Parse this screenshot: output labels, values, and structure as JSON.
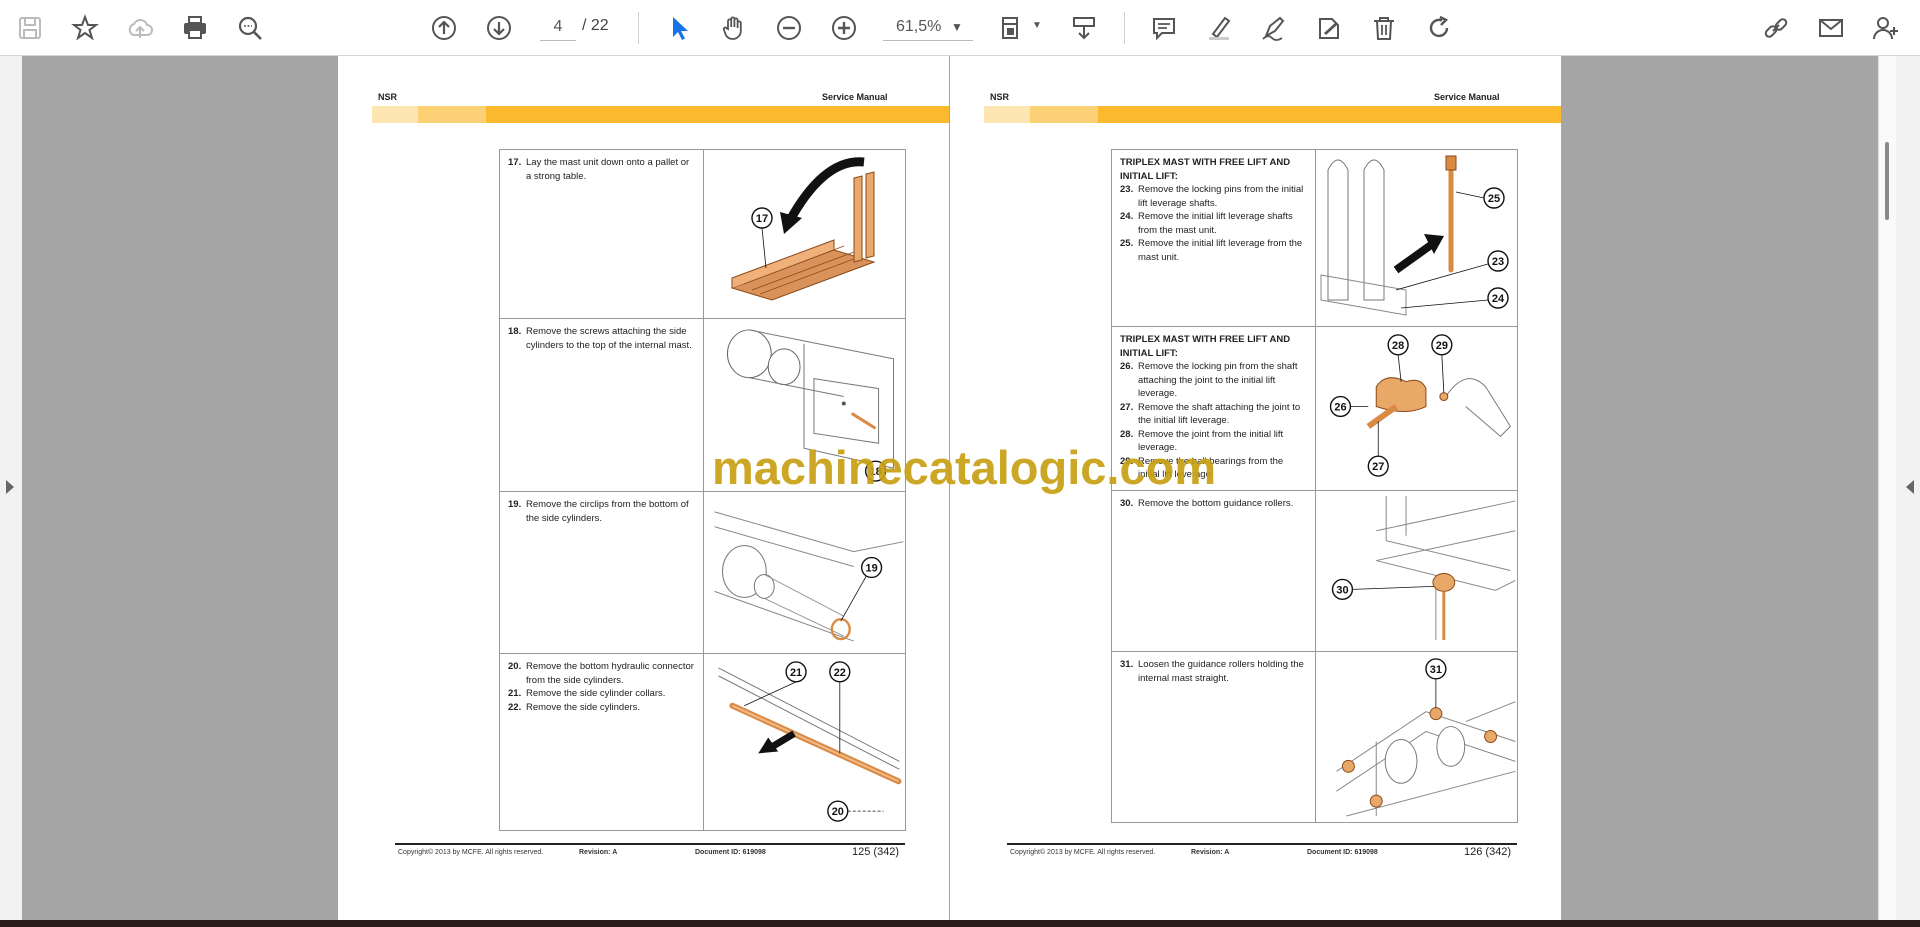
{
  "toolbar": {
    "page_current": "4",
    "page_total": "/ 22",
    "zoom": "61,5%",
    "icons": [
      "save-icon",
      "star-icon",
      "cloud-upload-icon",
      "print-icon",
      "zoom-search-icon",
      "page-up-icon",
      "page-down-icon",
      "select-cursor-icon",
      "hand-icon",
      "zoom-out-icon",
      "zoom-in-icon",
      "page-fit-icon",
      "scroll-mode-icon",
      "comment-icon",
      "highlight-icon",
      "draw-icon",
      "sign-icon",
      "delete-icon",
      "rotate-icon",
      "share-link-icon",
      "email-icon",
      "add-user-icon"
    ]
  },
  "watermark": "machinecatalogic.com",
  "pages": [
    {
      "header_left": "NSR",
      "header_right": "Service Manual",
      "rows": [
        {
          "steps": [
            {
              "n": "17.",
              "t": "Lay the mast unit down onto a pallet or a strong table."
            }
          ],
          "callouts": [
            "17"
          ]
        },
        {
          "steps": [
            {
              "n": "18.",
              "t": "Remove the screws attaching the side cylinders to the top of the internal mast."
            }
          ],
          "callouts": [
            "18"
          ]
        },
        {
          "steps": [
            {
              "n": "19.",
              "t": "Remove the circlips from the bottom of the side cylinders."
            }
          ],
          "callouts": [
            "19"
          ]
        },
        {
          "steps": [
            {
              "n": "20.",
              "t": "Remove the bottom hydraulic connector from the side cylinders."
            },
            {
              "n": "21.",
              "t": "Remove the side cylinder collars."
            },
            {
              "n": "22.",
              "t": "Remove the side cylinders."
            }
          ],
          "callouts": [
            "21",
            "22",
            "20"
          ]
        }
      ],
      "footer": {
        "copyright": "Copyright© 2013 by MCFE. All rights reserved.",
        "revision": "Revision:  A",
        "document": "Document ID: 619098",
        "page": "125 (342)"
      }
    },
    {
      "header_left": "NSR",
      "header_right": "Service Manual",
      "rows": [
        {
          "heading": "TRIPLEX MAST WITH FREE LIFT AND INITIAL LIFT:",
          "steps": [
            {
              "n": "23.",
              "t": "Remove the locking pins from the initial lift leverage shafts."
            },
            {
              "n": "24.",
              "t": "Remove the initial lift leverage shafts from the mast unit."
            },
            {
              "n": "25.",
              "t": "Remove the initial lift leverage from the mast unit."
            }
          ],
          "callouts": [
            "25",
            "23",
            "24"
          ]
        },
        {
          "heading": "TRIPLEX MAST WITH FREE LIFT AND INITIAL LIFT:",
          "steps": [
            {
              "n": "26.",
              "t": "Remove the locking pin from the shaft attaching the joint to the initial lift leverage."
            },
            {
              "n": "27.",
              "t": "Remove the shaft attaching the joint to the initial lift leverage."
            },
            {
              "n": "28.",
              "t": "Remove the joint from the initial lift leverage."
            },
            {
              "n": "29.",
              "t": "Remove the ball bearings from the initial lift leverage."
            }
          ],
          "callouts": [
            "28",
            "29",
            "26",
            "27"
          ]
        },
        {
          "steps": [
            {
              "n": "30.",
              "t": "Remove the bottom guidance rollers."
            }
          ],
          "callouts": [
            "30"
          ]
        },
        {
          "steps": [
            {
              "n": "31.",
              "t": "Loosen the guidance rollers holding the internal mast straight."
            }
          ],
          "callouts": [
            "31"
          ]
        }
      ],
      "footer": {
        "copyright": "Copyright© 2013 by MCFE. All rights reserved.",
        "revision": "Revision:  A",
        "document": "Document ID: 619098",
        "page": "126 (342)"
      }
    }
  ]
}
